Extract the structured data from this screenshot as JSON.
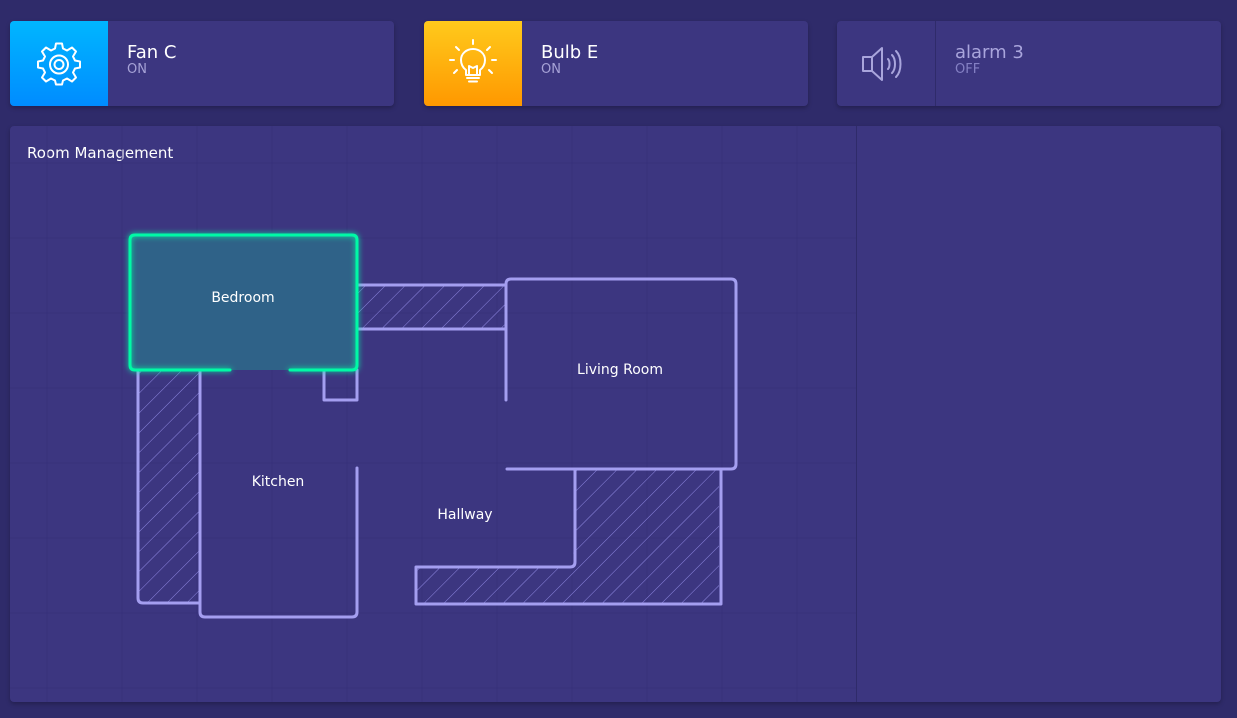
{
  "devices": [
    {
      "name": "Fan C",
      "status": "ON",
      "icon": "gear-icon",
      "color_top": "#00b3ff",
      "color_bottom": "#0090ff"
    },
    {
      "name": "Bulb E",
      "status": "ON",
      "icon": "lightbulb-icon",
      "color_top": "#ffc61a",
      "color_bottom": "#ff9a00"
    },
    {
      "name": "alarm 3",
      "status": "OFF",
      "icon": "speaker-icon"
    }
  ],
  "room_management": {
    "title": "Room Management",
    "rooms": {
      "bedroom": "Bedroom",
      "living_room": "Living Room",
      "kitchen": "Kitchen",
      "hallway": "Hallway"
    },
    "selected_room": "Bedroom",
    "wall_color": "#a49ef0",
    "selected_color": "#00f9a6"
  }
}
